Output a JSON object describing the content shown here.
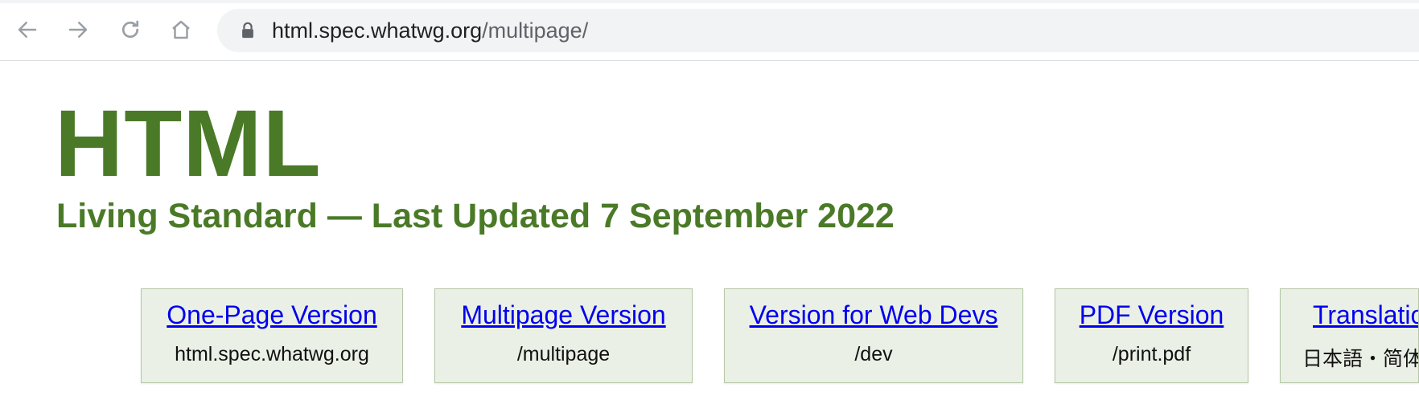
{
  "browser": {
    "nav": {
      "back_icon": "arrow-left-icon",
      "forward_icon": "arrow-right-icon",
      "reload_icon": "reload-icon",
      "home_icon": "home-icon"
    },
    "address_bar": {
      "lock_icon": "lock-icon",
      "url_host": "html.spec.whatwg.org",
      "url_path": "/multipage/"
    }
  },
  "page": {
    "title": "HTML",
    "subtitle": "Living Standard — Last Updated 7 September 2022",
    "versions": [
      {
        "link": "One-Page Version",
        "sub": "html.spec.whatwg.org"
      },
      {
        "link": "Multipage Version",
        "sub": "/multipage"
      },
      {
        "link": "Version for Web Devs",
        "sub": "/dev"
      },
      {
        "link": "PDF Version",
        "sub": "/print.pdf"
      },
      {
        "link": "Translatio",
        "sub": "日本語・简体"
      }
    ]
  },
  "colors": {
    "heading_green": "#4a7a27",
    "card_bg": "#eaf0e5",
    "link_blue": "#0000ee"
  }
}
